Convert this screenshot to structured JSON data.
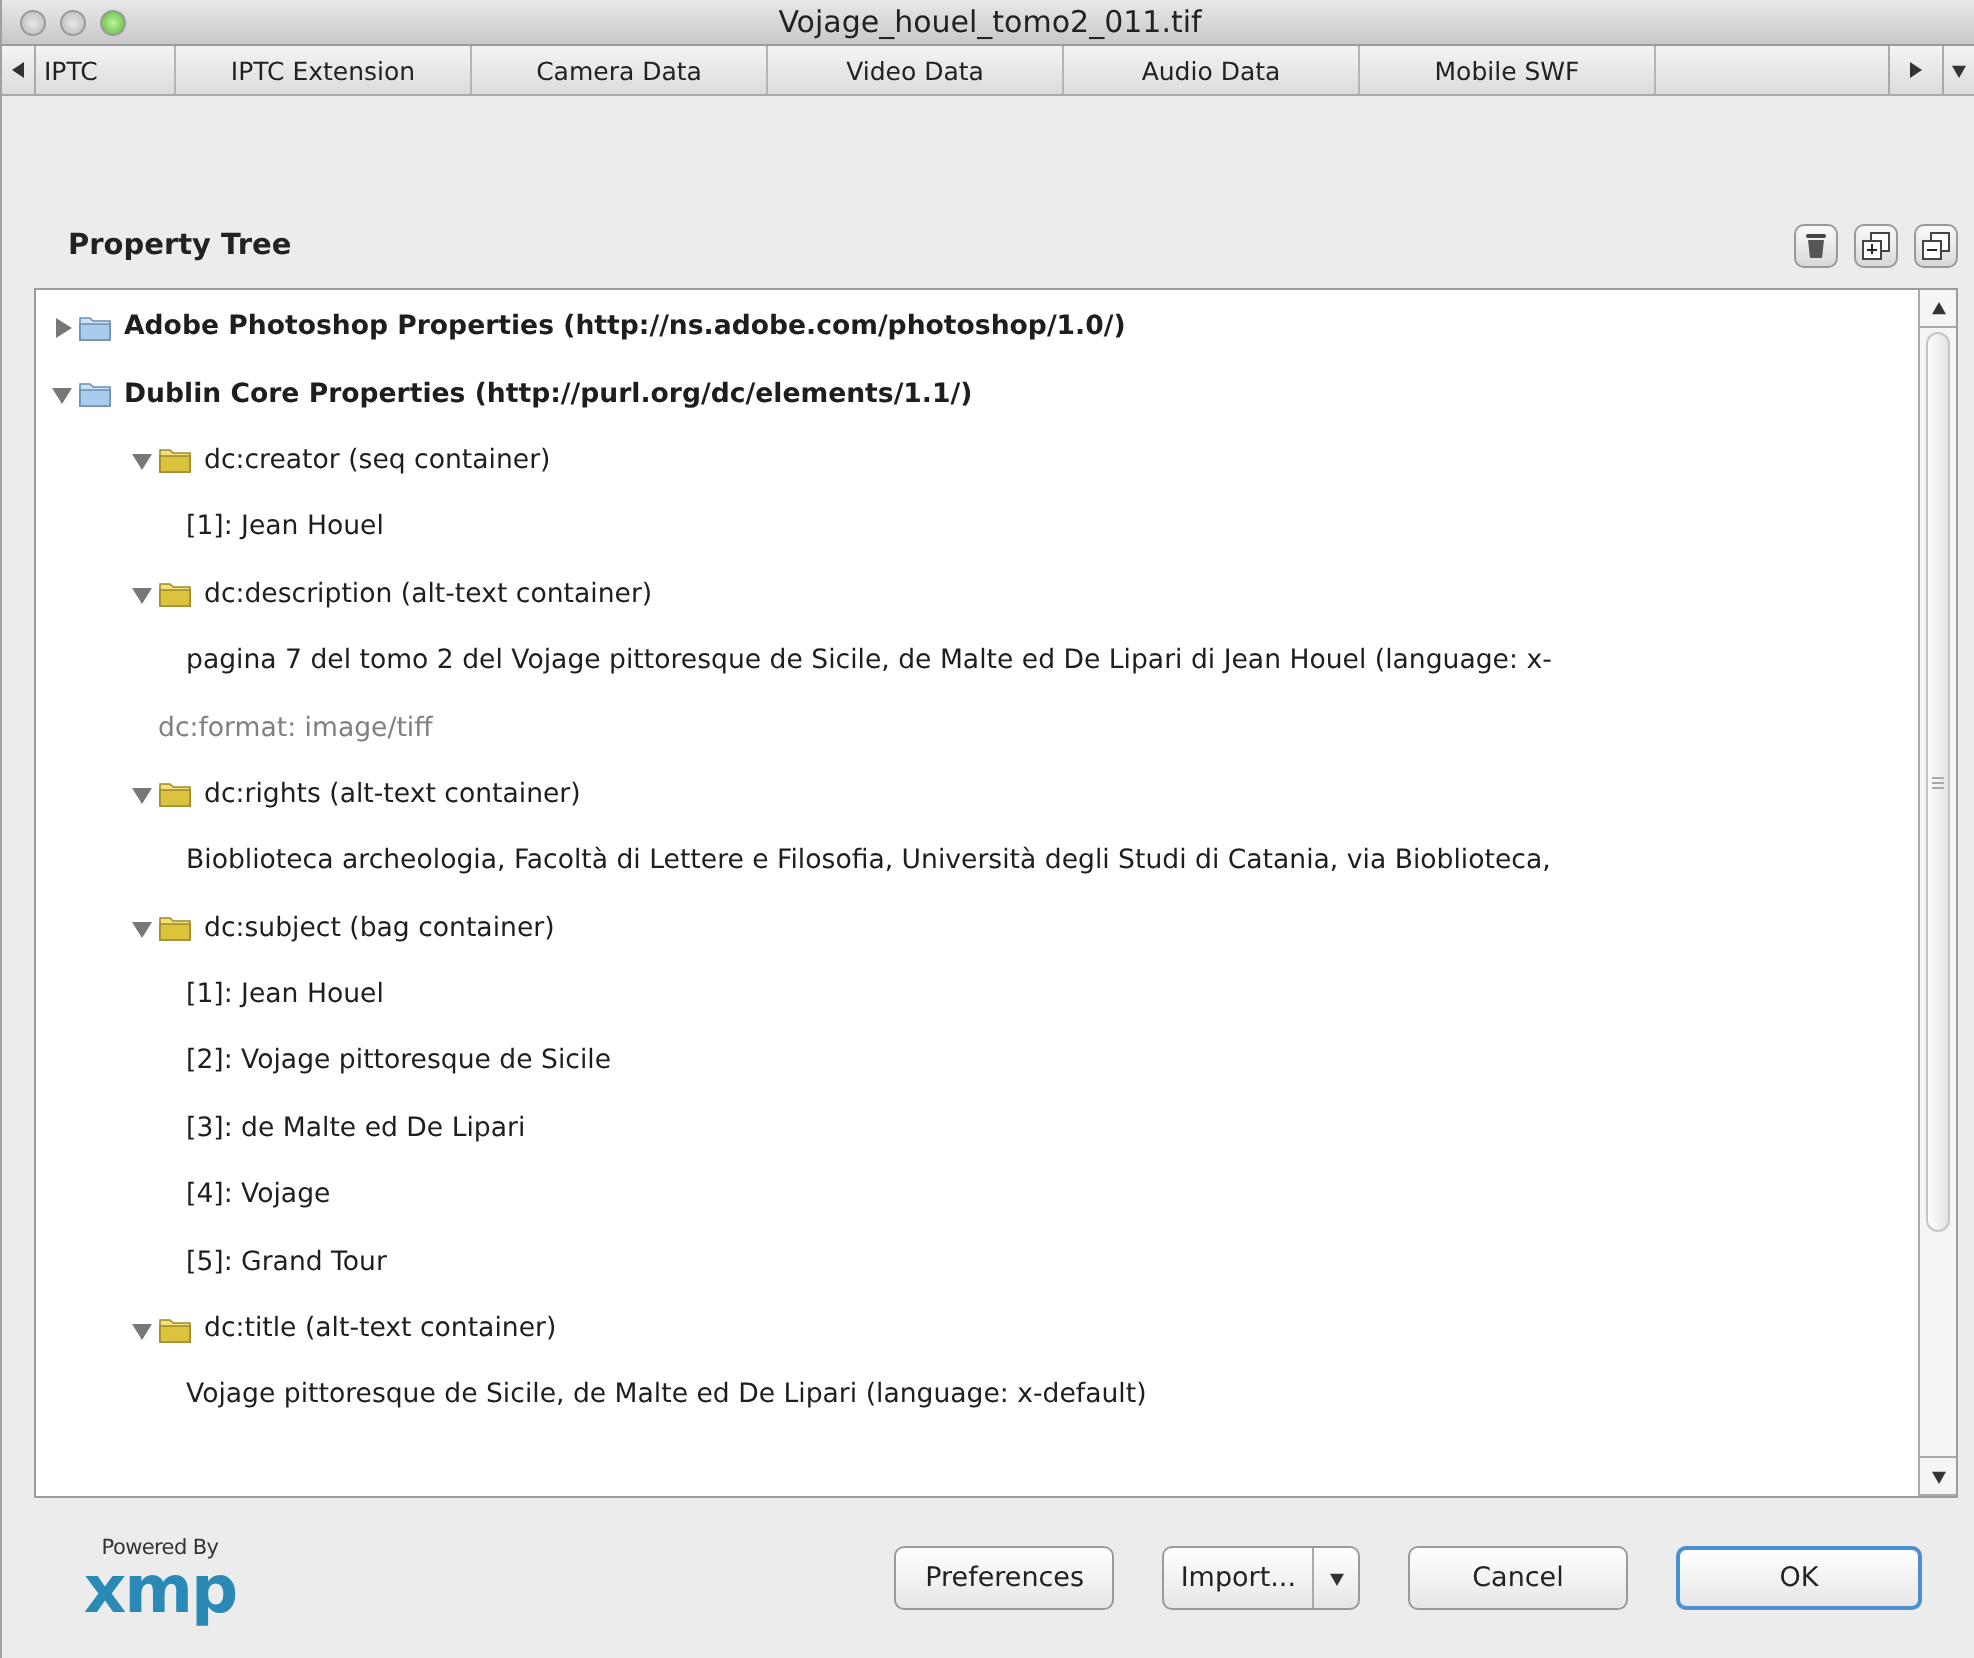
{
  "window": {
    "title": "Vojage_houel_tomo2_011.tif"
  },
  "tabs": [
    {
      "label": "IPTC",
      "selected": false
    },
    {
      "label": "IPTC Extension",
      "selected": false
    },
    {
      "label": "Camera Data",
      "selected": false
    },
    {
      "label": "Video Data",
      "selected": false
    },
    {
      "label": "Audio Data",
      "selected": false
    },
    {
      "label": "Mobile SWF",
      "selected": false
    }
  ],
  "panel": {
    "title": "Property Tree"
  },
  "tree": [
    {
      "kind": "namespace",
      "label": "Adobe Photoshop Properties (http://ns.adobe.com/photoshop/1.0/)",
      "expanded": false
    },
    {
      "kind": "namespace",
      "label": "Dublin Core Properties (http://purl.org/dc/elements/1.1/)",
      "expanded": true,
      "children": [
        {
          "kind": "container",
          "label": "dc:creator (seq container)",
          "expanded": true,
          "children": [
            {
              "kind": "value",
              "label": "[1]: Jean Houel"
            }
          ]
        },
        {
          "kind": "container",
          "label": "dc:description (alt-text container)",
          "expanded": true,
          "children": [
            {
              "kind": "value",
              "label": "pagina 7 del tomo 2 del Vojage pittoresque de Sicile, de Malte ed De Lipari di Jean Houel (language: x-"
            }
          ]
        },
        {
          "kind": "simple",
          "label": "dc:format: image/tiff"
        },
        {
          "kind": "container",
          "label": "dc:rights (alt-text container)",
          "expanded": true,
          "children": [
            {
              "kind": "value",
              "label": "Bioblioteca archeologia, Facoltà di Lettere e Filosofia, Università degli Studi di Catania, via Bioblioteca,"
            }
          ]
        },
        {
          "kind": "container",
          "label": "dc:subject (bag container)",
          "expanded": true,
          "children": [
            {
              "kind": "value",
              "label": "[1]: Jean Houel"
            },
            {
              "kind": "value",
              "label": "[2]: Vojage pittoresque de Sicile"
            },
            {
              "kind": "value",
              "label": "[3]: de Malte ed De Lipari"
            },
            {
              "kind": "value",
              "label": "[4]: Vojage"
            },
            {
              "kind": "value",
              "label": "[5]: Grand Tour"
            }
          ]
        },
        {
          "kind": "container",
          "label": "dc:title (alt-text container)",
          "expanded": true,
          "children": [
            {
              "kind": "value",
              "label": "Vojage pittoresque de Sicile, de Malte ed De Lipari (language: x-default)"
            }
          ]
        }
      ]
    }
  ],
  "footer": {
    "logo_caption": "Powered By",
    "logo": "xmp"
  },
  "buttons": [
    {
      "kind": "plain",
      "label": "Preferences",
      "default": false
    },
    {
      "kind": "split",
      "label": "Import...",
      "default": false
    },
    {
      "kind": "plain",
      "label": "Cancel",
      "default": false
    },
    {
      "kind": "plain",
      "label": "OK",
      "default": true
    }
  ]
}
